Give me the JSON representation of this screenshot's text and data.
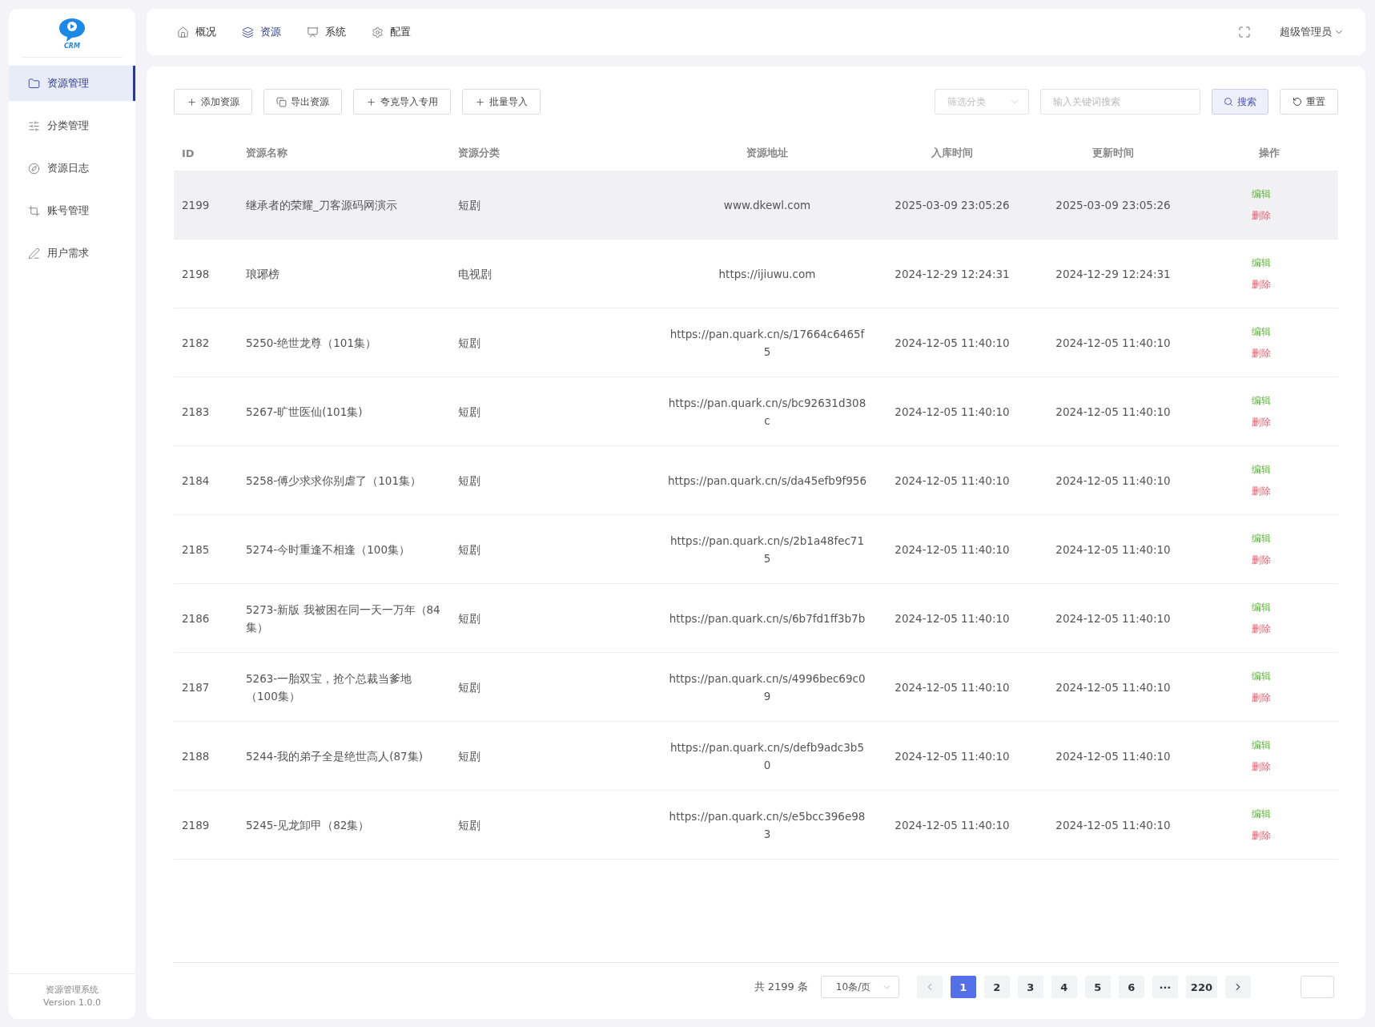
{
  "sidebar": {
    "logo_text": "CRM",
    "items": [
      {
        "label": "资源管理",
        "selected": true
      },
      {
        "label": "分类管理",
        "selected": false
      },
      {
        "label": "资源日志",
        "selected": false
      },
      {
        "label": "账号管理",
        "selected": false
      },
      {
        "label": "用户需求",
        "selected": false
      }
    ],
    "footer": {
      "title": "资源管理系统",
      "version": "Version 1.0.0"
    }
  },
  "top_nav": {
    "tabs": [
      {
        "label": "概况",
        "selected": false
      },
      {
        "label": "资源",
        "selected": true
      },
      {
        "label": "系统",
        "selected": false
      },
      {
        "label": "配置",
        "selected": false
      }
    ],
    "user": "超级管理员"
  },
  "toolbar": {
    "buttons": [
      {
        "label": "添加资源",
        "kind": "add"
      },
      {
        "label": "导出资源",
        "kind": "export"
      },
      {
        "label": "夸克导入专用",
        "kind": "add"
      },
      {
        "label": "批量导入",
        "kind": "add"
      }
    ],
    "filter": {
      "placeholder": "筛选分类"
    },
    "search": {
      "placeholder": "输入关键词搜索"
    },
    "search_button": "搜索",
    "reset_button": "重置"
  },
  "table": {
    "columns": [
      "ID",
      "资源名称",
      "资源分类",
      "资源地址",
      "入库时间",
      "更新时间",
      "操作"
    ],
    "rows": [
      {
        "id": "2199",
        "name": "继承者的荣耀_刀客源码网演示",
        "category": "短剧",
        "url": "www.dkewl.com",
        "created": "2025-03-09 23:05:26",
        "updated": "2025-03-09 23:05:26",
        "edit": "编辑",
        "delete": "删除",
        "hovered": true
      },
      {
        "id": "2198",
        "name": "琅琊榜",
        "category": "电视剧",
        "url": "https://ijiuwu.com",
        "created": "2024-12-29 12:24:31",
        "updated": "2024-12-29 12:24:31",
        "edit": "编辑",
        "delete": "删除",
        "hovered": false
      },
      {
        "id": "2182",
        "name": "5250-绝世龙尊（101集）",
        "category": "短剧",
        "url": "https://pan.quark.cn/s/17664c6465f5",
        "created": "2024-12-05 11:40:10",
        "updated": "2024-12-05 11:40:10",
        "edit": "编辑",
        "delete": "删除",
        "hovered": false
      },
      {
        "id": "2183",
        "name": "5267-旷世医仙(101集)",
        "category": "短剧",
        "url": "https://pan.quark.cn/s/bc92631d308c",
        "created": "2024-12-05 11:40:10",
        "updated": "2024-12-05 11:40:10",
        "edit": "编辑",
        "delete": "删除",
        "hovered": false
      },
      {
        "id": "2184",
        "name": "5258-傅少求求你别虐了（101集）",
        "category": "短剧",
        "url": "https://pan.quark.cn/s/da45efb9f956",
        "created": "2024-12-05 11:40:10",
        "updated": "2024-12-05 11:40:10",
        "edit": "编辑",
        "delete": "删除",
        "hovered": false
      },
      {
        "id": "2185",
        "name": "5274-今时重逢不相逢（100集）",
        "category": "短剧",
        "url": "https://pan.quark.cn/s/2b1a48fec715",
        "created": "2024-12-05 11:40:10",
        "updated": "2024-12-05 11:40:10",
        "edit": "编辑",
        "delete": "删除",
        "hovered": false
      },
      {
        "id": "2186",
        "name": "5273-新版 我被困在同一天一万年（84集）",
        "category": "短剧",
        "url": "https://pan.quark.cn/s/6b7fd1ff3b7b",
        "created": "2024-12-05 11:40:10",
        "updated": "2024-12-05 11:40:10",
        "edit": "编辑",
        "delete": "删除",
        "hovered": false
      },
      {
        "id": "2187",
        "name": "5263-一胎双宝，抢个总裁当爹地（100集）",
        "category": "短剧",
        "url": "https://pan.quark.cn/s/4996bec69c09",
        "created": "2024-12-05 11:40:10",
        "updated": "2024-12-05 11:40:10",
        "edit": "编辑",
        "delete": "删除",
        "hovered": false
      },
      {
        "id": "2188",
        "name": "5244-我的弟子全是绝世高人(87集)",
        "category": "短剧",
        "url": "https://pan.quark.cn/s/defb9adc3b50",
        "created": "2024-12-05 11:40:10",
        "updated": "2024-12-05 11:40:10",
        "edit": "编辑",
        "delete": "删除",
        "hovered": false
      },
      {
        "id": "2189",
        "name": "5245-见龙卸甲（82集）",
        "category": "短剧",
        "url": "https://pan.quark.cn/s/e5bcc396e983",
        "created": "2024-12-05 11:40:10",
        "updated": "2024-12-05 11:40:10",
        "edit": "编辑",
        "delete": "删除",
        "hovered": false
      }
    ]
  },
  "pagination": {
    "total": "共 2199 条",
    "page_size": "10条/页",
    "pages": [
      {
        "label": "1",
        "selected": true
      },
      {
        "label": "2",
        "selected": false
      },
      {
        "label": "3",
        "selected": false
      },
      {
        "label": "4",
        "selected": false
      },
      {
        "label": "5",
        "selected": false
      },
      {
        "label": "6",
        "selected": false
      },
      {
        "label": "···",
        "selected": false
      },
      {
        "label": "220",
        "selected": false
      }
    ]
  }
}
